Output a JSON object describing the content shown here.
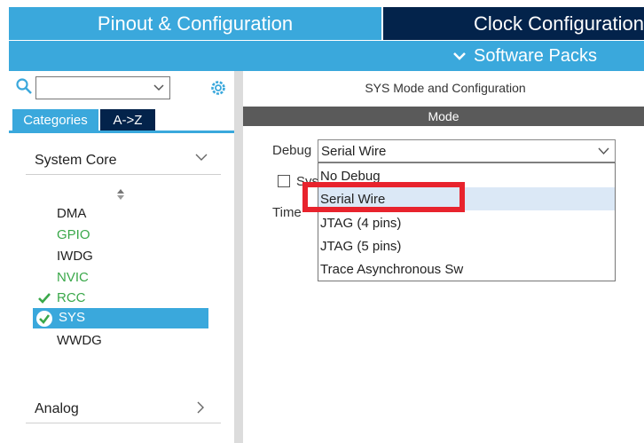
{
  "top_tabs": {
    "pinout": "Pinout & Configuration",
    "clock": "Clock Configuration"
  },
  "packs": {
    "label": "Software Packs"
  },
  "left": {
    "search_value": "",
    "tabs": [
      "Categories",
      "A->Z"
    ],
    "section_system_core": "System Core",
    "items": [
      "DMA",
      "GPIO",
      "IWDG",
      "NVIC",
      "RCC",
      "SYS",
      "WWDG"
    ],
    "section_analog": "Analog"
  },
  "right": {
    "title": "SYS Mode and Configuration",
    "mode_header": "Mode",
    "debug_label": "Debug",
    "debug_value": "Serial Wire",
    "sys_checkbox_label_fragment": "Sys",
    "timebase_label_fragment": "Time",
    "options": [
      "No Debug",
      "Serial Wire",
      "JTAG (4 pins)",
      "JTAG (5 pins)",
      "Trace Asynchronous Sw"
    ]
  },
  "colors": {
    "accent_blue": "#3aa8dc",
    "navy": "#03234b",
    "green": "#3aa84a",
    "highlight_red": "#e8232d"
  },
  "icons": [
    "search-icon",
    "gear-icon",
    "chevron-down-icon",
    "chevron-right-icon",
    "sort-icon",
    "check-icon",
    "check-circle-icon"
  ]
}
